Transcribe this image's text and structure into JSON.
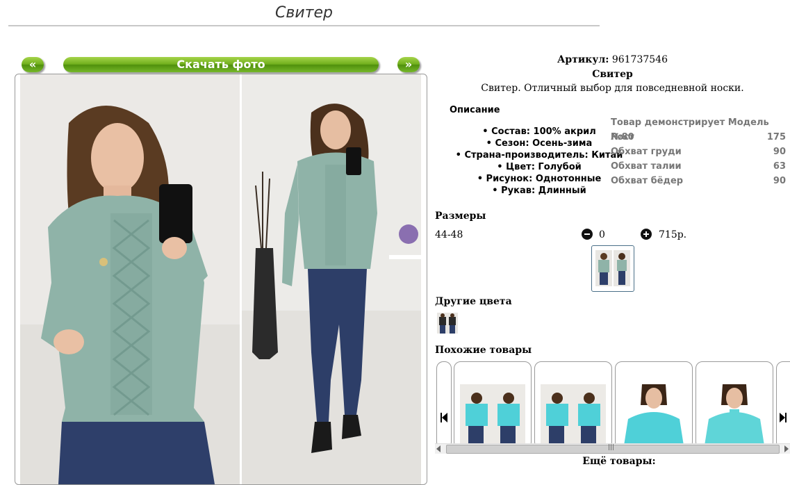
{
  "page": {
    "title": "Свитер"
  },
  "gallery": {
    "prev_label": "«",
    "download_label": "Скачать фото",
    "next_label": "»"
  },
  "product": {
    "article_label": "Артикул:",
    "article_value": "961737546",
    "name": "Свитер",
    "short_description": "Свитер. Отличный выбор для повседневной носки."
  },
  "description": {
    "title": "Описание",
    "items": [
      "Состав: 100% акрил",
      "Сезон: Осень-зима",
      "Страна-производитель: Китай",
      "Цвет: Голубой",
      "Рисунок: Однотонные",
      "Рукав: Длинный"
    ]
  },
  "model": {
    "rows": [
      {
        "label": "Товар демонстрирует Модель №80",
        "value": ""
      },
      {
        "label": "Рост",
        "value": "175"
      },
      {
        "label": "Обхват груди",
        "value": "90"
      },
      {
        "label": "Обхват талии",
        "value": "63"
      },
      {
        "label": "Обхват бёдер",
        "value": "90"
      }
    ]
  },
  "sizes": {
    "title": "Размеры",
    "size": "44-48",
    "quantity": "0",
    "price": "715р."
  },
  "other_colors": {
    "title": "Другие цвета"
  },
  "similar": {
    "title": "Похожие товары"
  },
  "more": {
    "title": "Ещё товары:"
  },
  "icons": {
    "minus": "minus-circle-icon",
    "plus": "plus-circle-icon",
    "prev": "skip-previous-icon",
    "next": "skip-next-icon"
  },
  "colors": {
    "accent": "#6fae1c",
    "sweater": "#8fb3a8",
    "similar_sweater": "#4fd0d8"
  }
}
